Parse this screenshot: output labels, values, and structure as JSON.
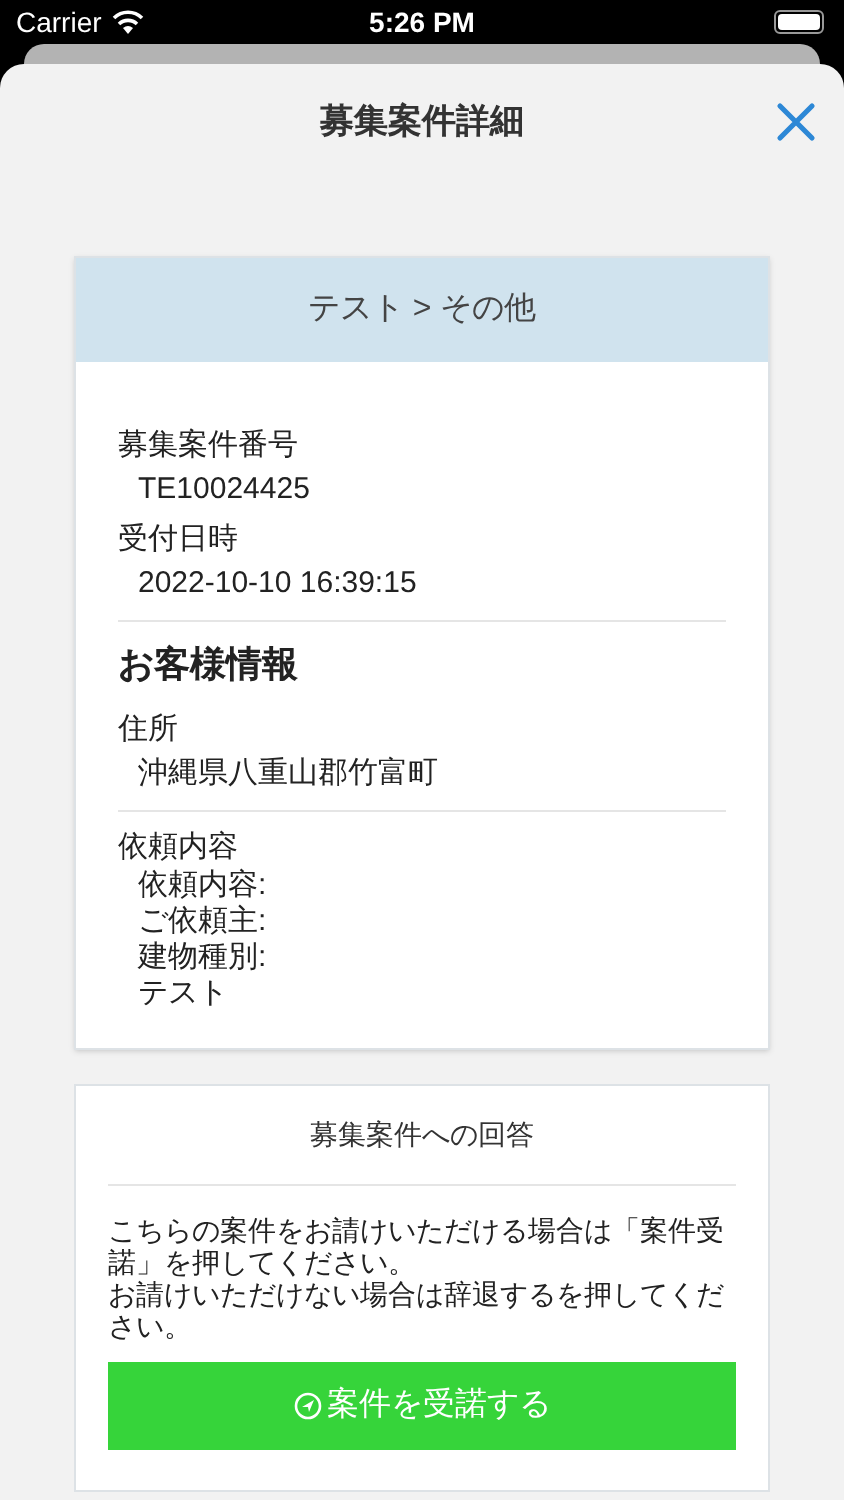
{
  "status_bar": {
    "carrier": "Carrier",
    "time": "5:26 PM"
  },
  "sheet": {
    "title": "募集案件詳細"
  },
  "detail_card": {
    "header": "テスト > その他",
    "sections": [
      {
        "kind": "fields",
        "fields": [
          {
            "label": "募集案件番号",
            "value": "TE10024425"
          },
          {
            "label": "受付日時",
            "value": "2022-10-10 16:39:15"
          }
        ]
      },
      {
        "kind": "fields",
        "heading": "お客様情報",
        "fields": [
          {
            "label": "住所",
            "value": "沖縄県八重山郡竹富町"
          }
        ]
      },
      {
        "kind": "fields",
        "fields": [
          {
            "label": "依頼内容",
            "lines": [
              "依頼内容:",
              "ご依頼主:",
              "建物種別:",
              "テスト"
            ]
          }
        ]
      }
    ]
  },
  "answer_card": {
    "title": "募集案件への回答",
    "message_lines": [
      "こちらの案件をお請けいただける場合は「案件受諾」を押してください。",
      "お請けいただけない場合は辞退するを押してください。"
    ],
    "accept_button": "案件を受諾する"
  }
}
